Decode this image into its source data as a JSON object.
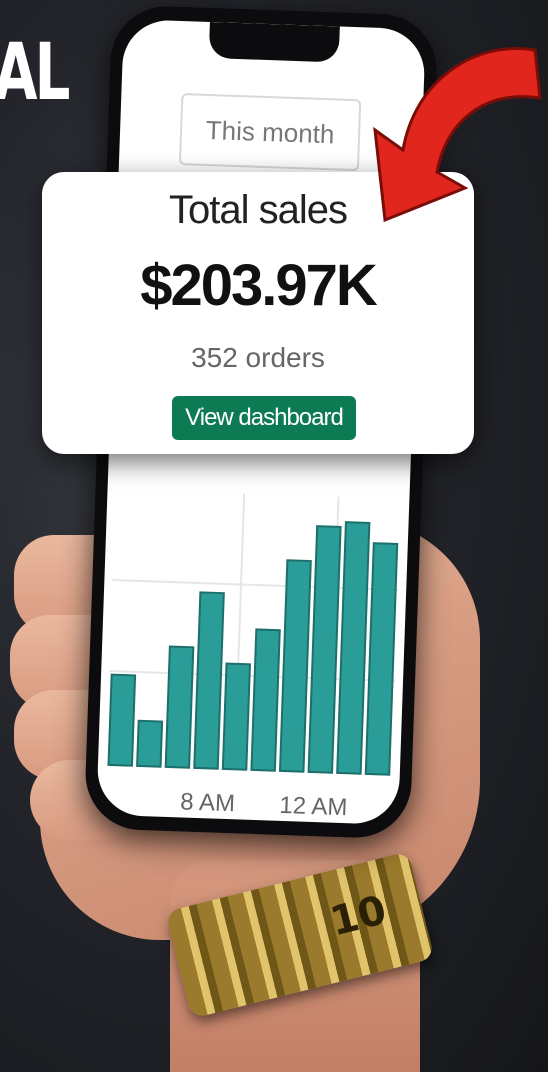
{
  "overlay_text": "AL",
  "filter": {
    "label": "This month"
  },
  "card": {
    "title": "Total sales",
    "value": "$203.97K",
    "orders": "352 orders",
    "button_label": "View dashboard"
  },
  "chart_data": {
    "type": "bar",
    "x_tick_labels": [
      "8 AM",
      "12 AM"
    ],
    "values": [
      36,
      18,
      48,
      70,
      42,
      56,
      84,
      98,
      100,
      92
    ],
    "ylim": [
      0,
      110
    ],
    "grid": true,
    "bar_color": "#2a9d98"
  },
  "watch_text": "10",
  "colors": {
    "accent": "#0c7a53",
    "arrow": "#e0261d",
    "bar": "#2a9d98"
  }
}
